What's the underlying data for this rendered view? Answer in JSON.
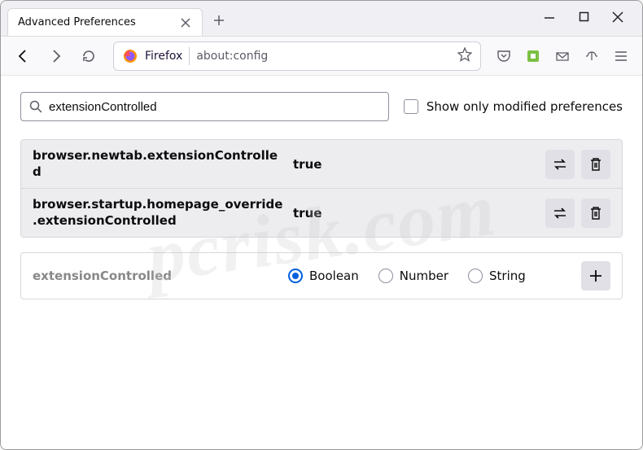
{
  "tab": {
    "title": "Advanced Preferences"
  },
  "urlbar": {
    "label": "Firefox",
    "address": "about:config"
  },
  "search": {
    "value": "extensionControlled",
    "show_modified_label": "Show only modified preferences"
  },
  "prefs": [
    {
      "name": "browser.newtab.extensionControlled",
      "value": "true"
    },
    {
      "name": "browser.startup.homepage_override.extensionControlled",
      "value": "true"
    }
  ],
  "new_pref": {
    "name": "extensionControlled",
    "types": [
      "Boolean",
      "Number",
      "String"
    ]
  },
  "watermark": "pcrisk.com"
}
